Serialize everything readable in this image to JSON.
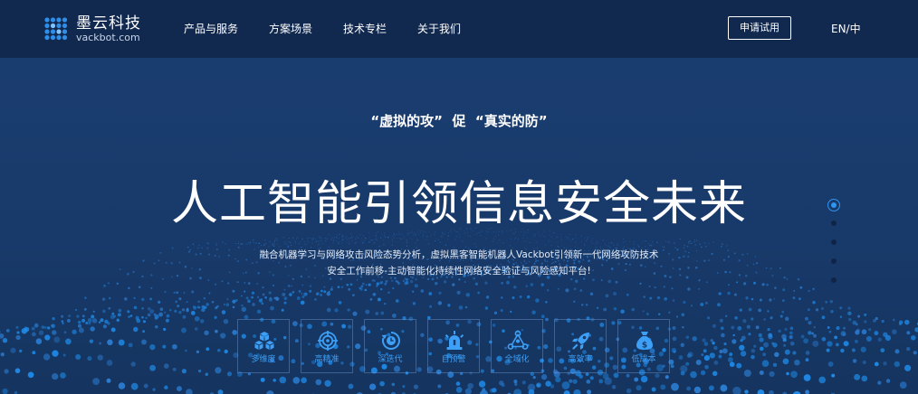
{
  "header": {
    "logo_cn": "墨云科技",
    "logo_en": "vackbot.com",
    "nav": [
      "产品与服务",
      "方案场景",
      "技术专栏",
      "关于我们"
    ],
    "trial_label": "申请试用",
    "lang_label": "EN/中"
  },
  "hero": {
    "quote": "“虚拟的攻”  促  “真实的防”",
    "headline": "人工智能引领信息安全未来",
    "desc_line1": "融合机器学习与网络攻击风险态势分析，虚拟黑客智能机器人Vackbot引领新一代网络攻防技术",
    "desc_line2": "安全工作前移-主动智能化持续性网络安全验证与风险感知平台!",
    "features": [
      {
        "label": "多维度",
        "icon": "cubes-icon"
      },
      {
        "label": "高精准",
        "icon": "target-icon"
      },
      {
        "label": "深迭代",
        "icon": "iteration-icon"
      },
      {
        "label": "自预警",
        "icon": "alarm-icon"
      },
      {
        "label": "全域化",
        "icon": "network-icon"
      },
      {
        "label": "高效率",
        "icon": "rocket-icon"
      },
      {
        "label": "低成本",
        "icon": "moneybag-icon"
      }
    ],
    "slide_count": 5,
    "active_slide": 1
  },
  "colors": {
    "header_bg": "#11284f",
    "hero_bg": "#173a6b",
    "accent": "#2e95f0",
    "feature_label": "#3d9ff5"
  }
}
